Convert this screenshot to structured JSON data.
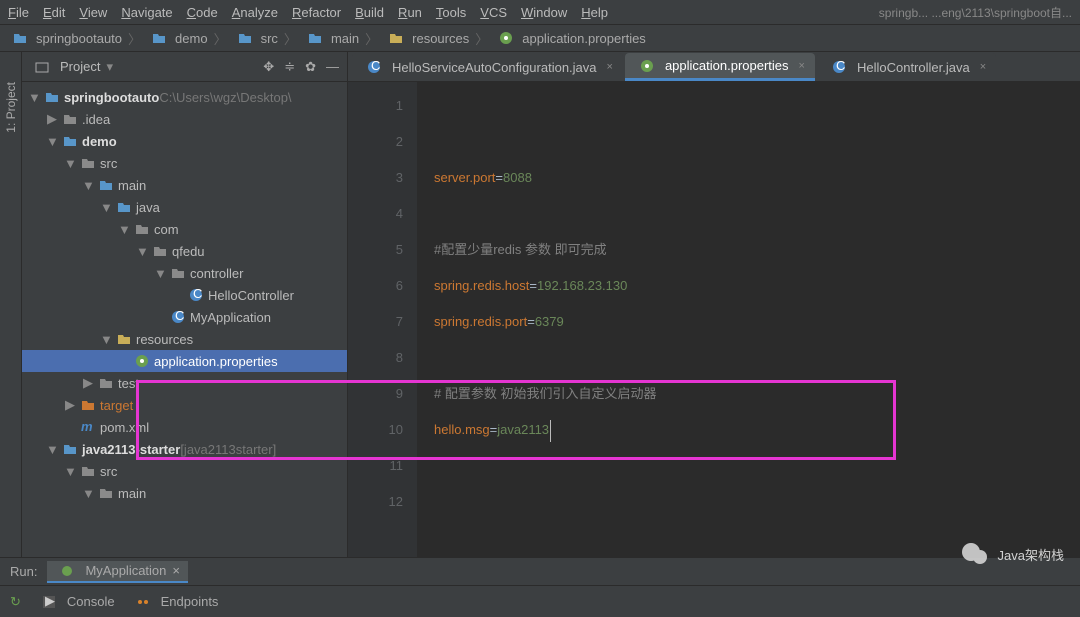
{
  "menu": {
    "items": [
      "File",
      "Edit",
      "View",
      "Navigate",
      "Code",
      "Analyze",
      "Refactor",
      "Build",
      "Run",
      "Tools",
      "VCS",
      "Window",
      "Help"
    ],
    "title_extra": "springb...   ...eng\\2113\\springboot自..."
  },
  "breadcrumbs": [
    {
      "icon": "folder",
      "label": "springbootauto"
    },
    {
      "icon": "folder",
      "label": "demo"
    },
    {
      "icon": "folder",
      "label": "src"
    },
    {
      "icon": "folder",
      "label": "main"
    },
    {
      "icon": "folder-res",
      "label": "resources"
    },
    {
      "icon": "props",
      "label": "application.properties"
    }
  ],
  "sidebar": {
    "title": "Project",
    "vertical_label": "1: Project",
    "tree": [
      {
        "depth": 0,
        "arrow": "▼",
        "icon": "folder-root",
        "label": "springbootauto",
        "suffix": " C:\\Users\\wgz\\Desktop\\",
        "bold": true
      },
      {
        "depth": 1,
        "arrow": "▶",
        "icon": "folder-grey",
        "label": ".idea"
      },
      {
        "depth": 1,
        "arrow": "▼",
        "icon": "folder-blue",
        "label": "demo",
        "bold": true
      },
      {
        "depth": 2,
        "arrow": "▼",
        "icon": "folder-grey",
        "label": "src"
      },
      {
        "depth": 3,
        "arrow": "▼",
        "icon": "folder-blue",
        "label": "main"
      },
      {
        "depth": 4,
        "arrow": "▼",
        "icon": "folder-blue",
        "label": "java"
      },
      {
        "depth": 5,
        "arrow": "▼",
        "icon": "folder-grey",
        "label": "com"
      },
      {
        "depth": 6,
        "arrow": "▼",
        "icon": "folder-grey",
        "label": "qfedu"
      },
      {
        "depth": 7,
        "arrow": "▼",
        "icon": "folder-grey",
        "label": "controller"
      },
      {
        "depth": 8,
        "arrow": "",
        "icon": "class",
        "label": "HelloController"
      },
      {
        "depth": 7,
        "arrow": "",
        "icon": "class-run",
        "label": "MyApplication"
      },
      {
        "depth": 4,
        "arrow": "▼",
        "icon": "folder-res",
        "label": "resources"
      },
      {
        "depth": 5,
        "arrow": "",
        "icon": "props",
        "label": "application.properties",
        "selected": true
      },
      {
        "depth": 3,
        "arrow": "▶",
        "icon": "folder-grey",
        "label": "test"
      },
      {
        "depth": 2,
        "arrow": "▶",
        "icon": "folder-orange",
        "label": "target",
        "orange": true
      },
      {
        "depth": 2,
        "arrow": "",
        "icon": "maven",
        "label": "pom.xml"
      },
      {
        "depth": 1,
        "arrow": "▼",
        "icon": "folder-blue",
        "label": "java2113-starter ",
        "suffix": "[java2113starter]",
        "bold": true
      },
      {
        "depth": 2,
        "arrow": "▼",
        "icon": "folder-grey",
        "label": "src"
      },
      {
        "depth": 3,
        "arrow": "▼",
        "icon": "folder-grey",
        "label": "main"
      }
    ]
  },
  "tabs": [
    {
      "icon": "class",
      "label": "HelloServiceAutoConfiguration.java",
      "active": false
    },
    {
      "icon": "props",
      "label": "application.properties",
      "active": true
    },
    {
      "icon": "class",
      "label": "HelloController.java",
      "active": false
    }
  ],
  "code": {
    "lines": [
      {
        "n": 1,
        "seg": []
      },
      {
        "n": 2,
        "seg": []
      },
      {
        "n": 3,
        "seg": [
          {
            "t": "server.port",
            "c": "key"
          },
          {
            "t": "=",
            "c": ""
          },
          {
            "t": "8088",
            "c": "val"
          }
        ]
      },
      {
        "n": 4,
        "seg": []
      },
      {
        "n": 5,
        "seg": [
          {
            "t": "#配置少量redis 参数 即可完成",
            "c": "cmt"
          }
        ]
      },
      {
        "n": 6,
        "seg": [
          {
            "t": "spring.redis.host",
            "c": "key"
          },
          {
            "t": "=",
            "c": ""
          },
          {
            "t": "192.168.23.130",
            "c": "val"
          }
        ]
      },
      {
        "n": 7,
        "seg": [
          {
            "t": "spring.redis.port",
            "c": "key"
          },
          {
            "t": "=",
            "c": ""
          },
          {
            "t": "6379",
            "c": "val"
          }
        ]
      },
      {
        "n": 8,
        "seg": []
      },
      {
        "n": 9,
        "seg": [
          {
            "t": "# 配置参数 初始我们引入自定义启动器",
            "c": "cmt"
          }
        ]
      },
      {
        "n": 10,
        "seg": [
          {
            "t": "hello.msg",
            "c": "key"
          },
          {
            "t": "=",
            "c": ""
          },
          {
            "t": "java2113",
            "c": "val"
          }
        ],
        "cursor": true
      },
      {
        "n": 11,
        "seg": []
      },
      {
        "n": 12,
        "seg": []
      }
    ]
  },
  "run": {
    "label": "Run:",
    "app": "MyApplication"
  },
  "toolbar": {
    "console": "Console",
    "endpoints": "Endpoints"
  },
  "watermark": "Java架构栈"
}
